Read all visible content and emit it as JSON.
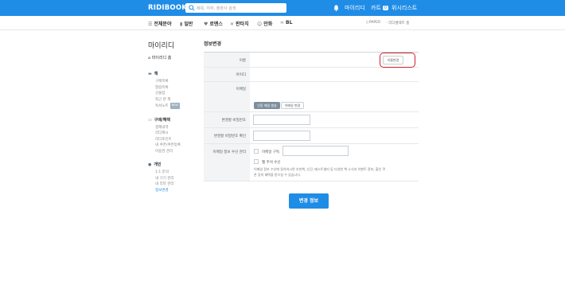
{
  "header": {
    "logo": "RIDIBOOKS",
    "search_placeholder": "제목, 저자, 출판사 검색",
    "my_ridi": "마이리디",
    "cart": "카트",
    "cart_count": "0",
    "wishlist": "위시리스트"
  },
  "categories": {
    "all": "전체분야",
    "general": "일반",
    "romance": "로맨스",
    "fantasy": "판타지",
    "comic": "만화",
    "bl": "BL",
    "paper": "PAPER",
    "select": "리디셀렉트 홈"
  },
  "sidebar": {
    "title": "마이리디",
    "home": "마이리디 홈",
    "book_section": "책",
    "book_items": [
      "구매목록",
      "열람목록",
      "선물함",
      "최근 본 책",
      "독서노트"
    ],
    "new_badge": "NEW",
    "purchase_section": "구매/혜택",
    "purchase_items": [
      "결제내역",
      "리디캐시",
      "리디포인트",
      "내 쿠폰/쿠폰등록",
      "이용권 관리"
    ],
    "account_section": "개인",
    "account_items": [
      "1:1 문의",
      "내 기기 관리",
      "내 리뷰 관리",
      "정보변경"
    ]
  },
  "main": {
    "title": "정보변경",
    "name_label": "이름",
    "name_change_button": "이름변경",
    "id_label": "아이디",
    "email_label": "이메일",
    "email_auth_button": "인증 메일 발송",
    "email_change_button": "이메일 변경",
    "new_pw_label": "변경할 비밀번호",
    "new_pw_confirm_label": "변경할 비밀번호 확인",
    "email_pref_label": "이메일 정보 수신 관리",
    "email_subscribe": "이메일 구독",
    "mail_read": "웹 주석 수신",
    "email_desc_1": "이메일 정보 수신에 동의하시면 추천책, 신간, 베스트셀러 등 다양한 책 소식과 이벤트 정보, 할인 쿠",
    "email_desc_2": "폰 등의 혜택을 받으실 수 있습니다.",
    "submit": "변경 정보"
  }
}
